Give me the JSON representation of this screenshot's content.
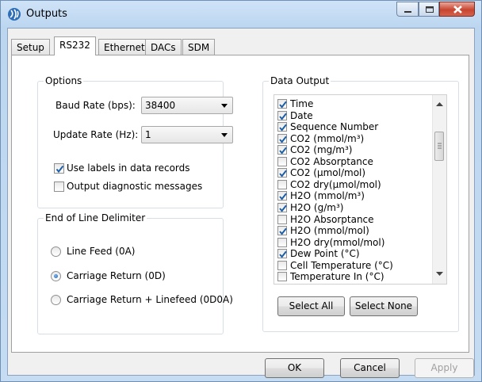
{
  "window": {
    "title": "Outputs",
    "icon": "gear-icon"
  },
  "tabs": [
    {
      "label": "Setup"
    },
    {
      "label": "RS232"
    },
    {
      "label": "Ethernet"
    },
    {
      "label": "DACs"
    },
    {
      "label": "SDM"
    }
  ],
  "active_tab": "RS232",
  "options": {
    "legend": "Options",
    "baud_label": "Baud Rate (bps):",
    "baud_value": "38400",
    "update_label": "Update Rate (Hz):",
    "update_value": "1",
    "use_labels": {
      "label": "Use labels in data records",
      "checked": true
    },
    "diagnostics": {
      "label": "Output diagnostic messages",
      "checked": false
    }
  },
  "eol": {
    "legend": "End of Line Delimiter",
    "choices": [
      {
        "label": "Line Feed (0A)",
        "selected": false
      },
      {
        "label": "Carriage Return (0D)",
        "selected": true
      },
      {
        "label": "Carriage Return + Linefeed (0D0A)",
        "selected": false
      }
    ]
  },
  "data_output": {
    "legend": "Data Output",
    "items": [
      {
        "label": "Time",
        "checked": true
      },
      {
        "label": "Date",
        "checked": true
      },
      {
        "label": "Sequence Number",
        "checked": true
      },
      {
        "label": "CO2 (mmol/m³)",
        "checked": true
      },
      {
        "label": "CO2 (mg/m³)",
        "checked": true
      },
      {
        "label": "CO2 Absorptance",
        "checked": false
      },
      {
        "label": "CO2 (µmol/mol)",
        "checked": true
      },
      {
        "label": "CO2 dry(µmol/mol)",
        "checked": false
      },
      {
        "label": "H2O (mmol/m³)",
        "checked": true
      },
      {
        "label": "H2O (g/m³)",
        "checked": true
      },
      {
        "label": "H2O Absorptance",
        "checked": false
      },
      {
        "label": "H2O (mmol/mol)",
        "checked": true
      },
      {
        "label": "H2O dry(mmol/mol)",
        "checked": false
      },
      {
        "label": "Dew Point (°C)",
        "checked": true
      },
      {
        "label": "Cell Temperature (°C)",
        "checked": false
      },
      {
        "label": "Temperature In (°C)",
        "checked": false
      }
    ],
    "select_all": "Select All",
    "select_none": "Select None"
  },
  "footer": {
    "ok": "OK",
    "cancel": "Cancel",
    "apply": "Apply"
  },
  "colors": {
    "titlebar": "#c5dcf2",
    "close": "#c7452f",
    "check": "#1d5fa8"
  }
}
